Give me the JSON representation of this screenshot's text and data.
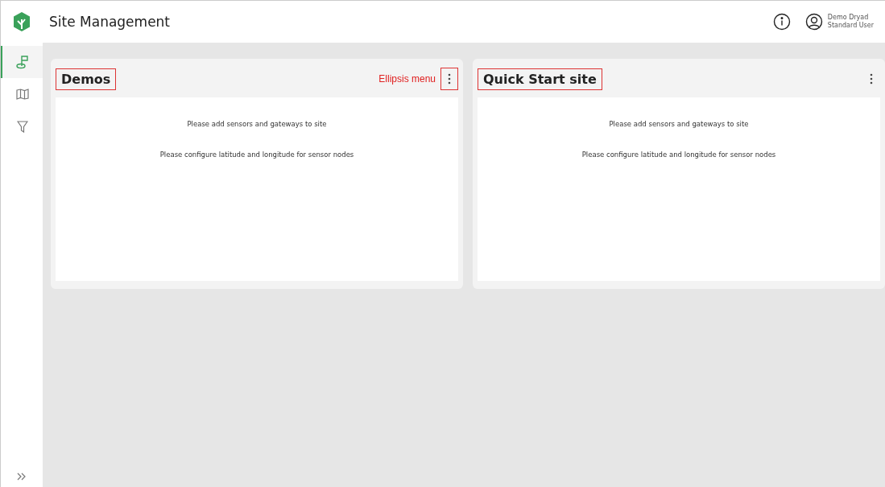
{
  "header": {
    "title": "Site Management",
    "user": {
      "name": "Demo Dryad",
      "role": "Standard User"
    }
  },
  "nav": [
    {
      "kind": "sites",
      "selected": true
    },
    {
      "kind": "map",
      "selected": false
    },
    {
      "kind": "filter",
      "selected": false
    }
  ],
  "cards": [
    {
      "title": "Demos",
      "highlighted": true,
      "menu_highlighted": true,
      "annotation": "Ellipsis menu",
      "messages": [
        "Please add sensors and gateways to site",
        "Please configure latitude and longitude for sensor nodes"
      ]
    },
    {
      "title": "Quick Start site",
      "highlighted": true,
      "menu_highlighted": false,
      "messages": [
        "Please add sensors and gateways to site",
        "Please configure latitude and longitude for sensor nodes"
      ]
    }
  ]
}
